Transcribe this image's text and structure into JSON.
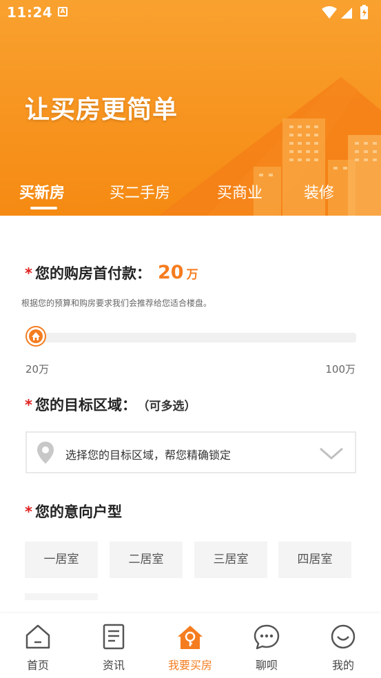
{
  "status_bar": {
    "time": "11:24",
    "notif_badge": "A"
  },
  "header": {
    "title": "让买房更简单",
    "tabs": [
      {
        "label": "买新房",
        "active": true
      },
      {
        "label": "买二手房",
        "active": false
      },
      {
        "label": "买商业",
        "active": false
      },
      {
        "label": "装修",
        "active": false
      }
    ]
  },
  "down_payment": {
    "required_mark": "*",
    "label": "您的购房首付款：",
    "value": "20",
    "unit": "万",
    "hint": "根据您的预算和购房要求我们会推荐给您适合楼盘。",
    "slider": {
      "min_label": "20万",
      "max_label": "100万",
      "position": 0
    }
  },
  "target_area": {
    "required_mark": "*",
    "label": "您的目标区域：",
    "note": "（可多选）",
    "placeholder": "选择您的目标区域，帮您精确锁定"
  },
  "room_type": {
    "required_mark": "*",
    "label": "您的意向户型",
    "options": [
      "一居室",
      "二居室",
      "三居室",
      "四居室"
    ]
  },
  "bottom_nav": [
    {
      "label": "首页",
      "icon": "home-icon",
      "active": false
    },
    {
      "label": "资讯",
      "icon": "news-icon",
      "active": false
    },
    {
      "label": "我要买房",
      "icon": "house-key-icon",
      "active": true
    },
    {
      "label": "聊呗",
      "icon": "chat-icon",
      "active": false
    },
    {
      "label": "我的",
      "icon": "smile-icon",
      "active": false
    }
  ],
  "colors": {
    "accent": "#f57c1f",
    "header_orange": "#f7931e",
    "required": "#e02020"
  }
}
